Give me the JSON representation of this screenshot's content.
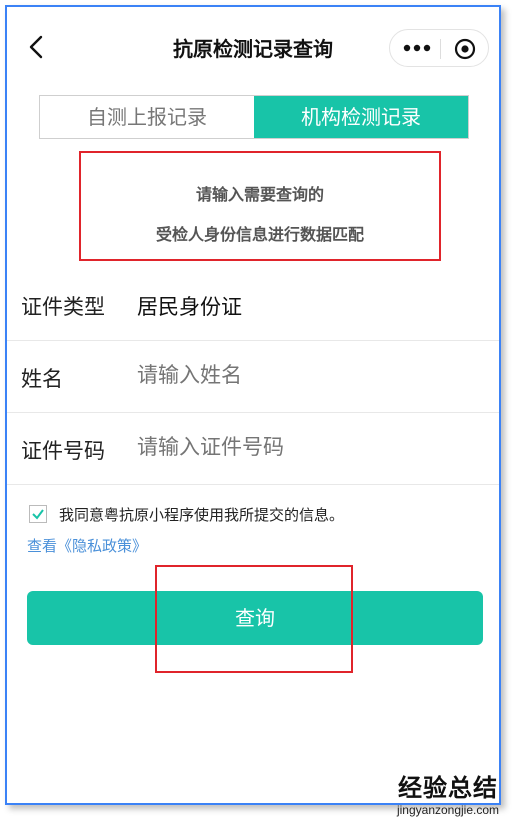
{
  "navbar": {
    "title": "抗原检测记录查询",
    "back_icon": "chevron-left-icon",
    "more_icon": "more-dots-icon",
    "close_icon": "target-icon"
  },
  "tabs": [
    {
      "label": "自测上报记录",
      "active": false
    },
    {
      "label": "机构检测记录",
      "active": true
    }
  ],
  "notice": {
    "line1": "请输入需要查询的",
    "line2": "受检人身份信息进行数据匹配"
  },
  "form": {
    "id_type": {
      "label": "证件类型",
      "value": "居民身份证"
    },
    "name": {
      "label": "姓名",
      "placeholder": "请输入姓名"
    },
    "id_number": {
      "label": "证件号码",
      "placeholder": "请输入证件号码"
    }
  },
  "consent": {
    "checked": true,
    "text": "我同意粤抗原小程序使用我所提交的信息。",
    "privacy_link": "查看《隐私政策》"
  },
  "query_button": {
    "label": "查询"
  },
  "watermark": {
    "main": "经验总结",
    "url": "jingyanzongjie.com"
  },
  "colors": {
    "accent": "#18c4a8",
    "annotation": "#e0242b",
    "link": "#4a90d9"
  }
}
